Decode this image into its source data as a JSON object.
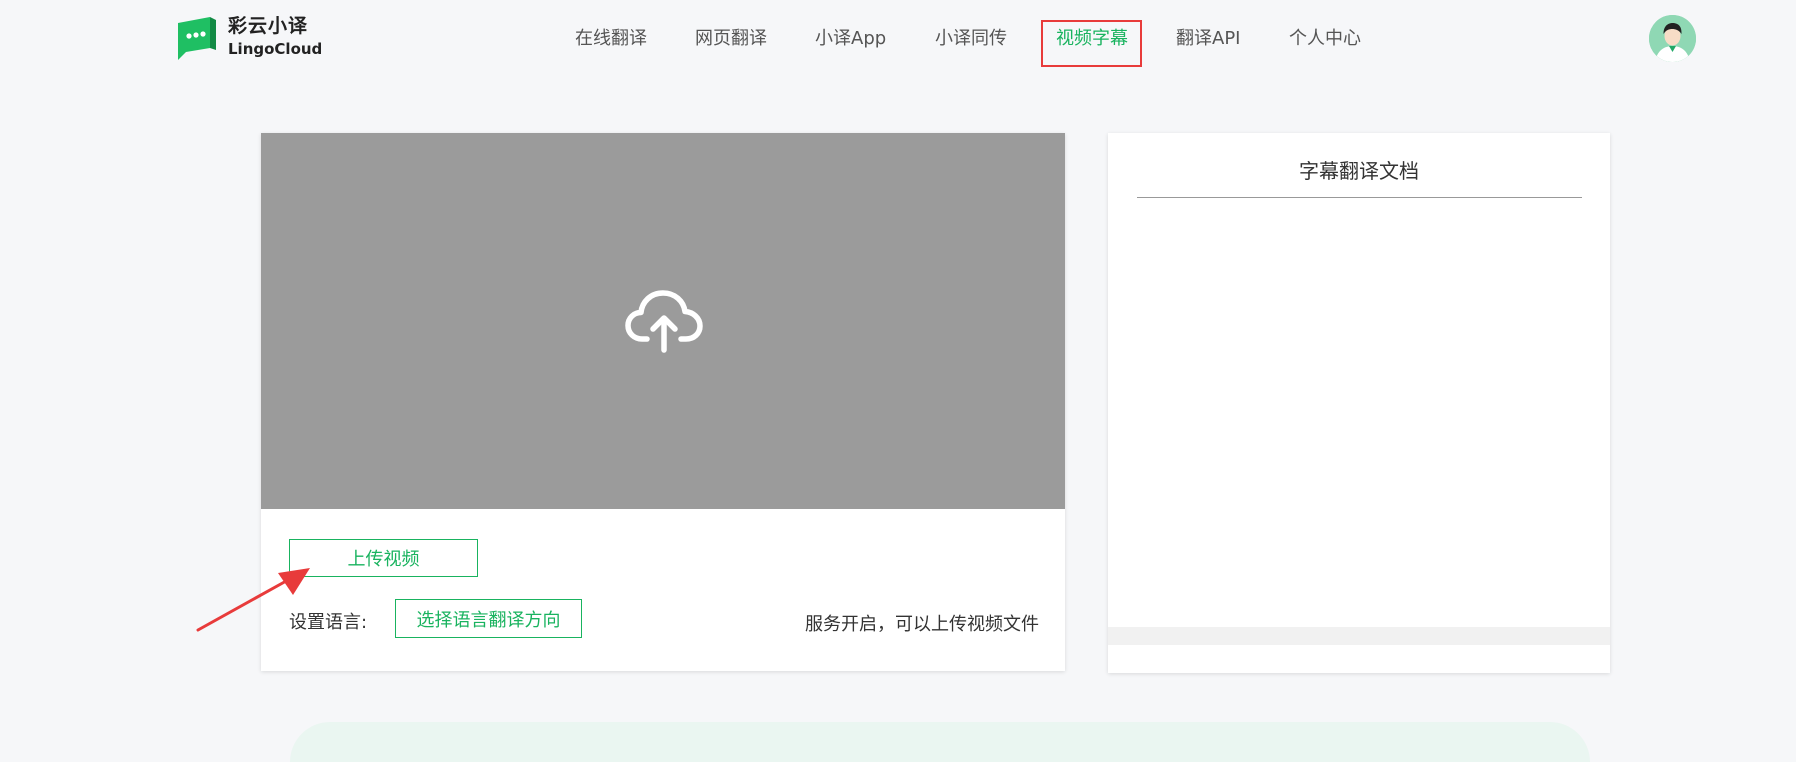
{
  "header": {
    "logo": {
      "name_cn": "彩云小译",
      "name_en": "LingoCloud"
    },
    "nav": [
      {
        "label": "在线翻译",
        "active": false
      },
      {
        "label": "网页翻译",
        "active": false
      },
      {
        "label": "小译App",
        "active": false
      },
      {
        "label": "小译同传",
        "active": false
      },
      {
        "label": "视频字幕",
        "active": true
      },
      {
        "label": "翻译API",
        "active": false
      },
      {
        "label": "个人中心",
        "active": false
      }
    ]
  },
  "upload_card": {
    "upload_button": "上传视频",
    "language_label": "设置语言:",
    "language_button": "选择语言翻译方向",
    "status": "服务开启，可以上传视频文件"
  },
  "subtitle_panel": {
    "title": "字幕翻译文档"
  },
  "colors": {
    "accent": "#19b35f",
    "annotation": "#e83b3b",
    "upload_area": "#9b9b9b"
  },
  "icons": {
    "upload": "cloud-upload-icon",
    "logo": "chat-bubble-logo-icon",
    "avatar": "user-avatar-icon"
  }
}
